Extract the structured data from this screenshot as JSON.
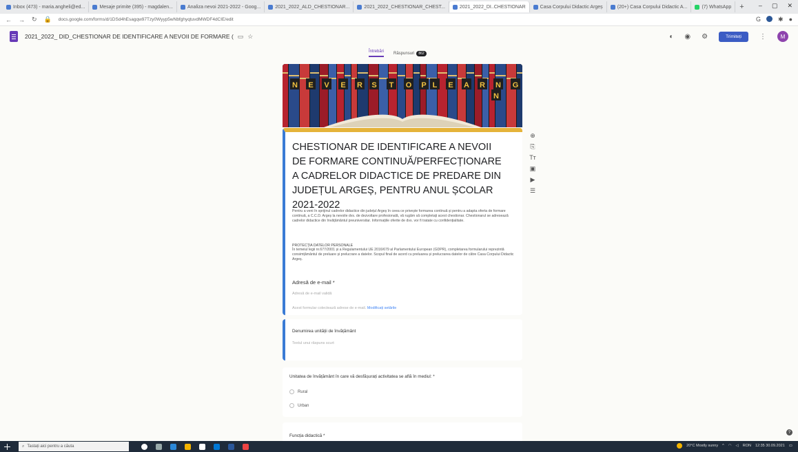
{
  "browser": {
    "tabs": [
      {
        "label": "Inbox (473) - maria.angheli@ed..."
      },
      {
        "label": "Mesaje primite (395) - magdalen..."
      },
      {
        "label": "Analiza nevoi 2021-2022 - Goog..."
      },
      {
        "label": "2021_2022_ALD_CHESTIONAR..."
      },
      {
        "label": "2021_2022_CHESTIONAR_CHEST..."
      },
      {
        "label": "2021_2022_DI..CHESTIONAR"
      },
      {
        "label": "Casa Corpului Didactic Argeș"
      },
      {
        "label": "(20+) Casa Corpului Didactic A..."
      },
      {
        "label": "(7) WhatsApp"
      }
    ],
    "new_tab": "+",
    "url": "docs.google.com/forms/d/1DSd4hEsagqw97Tzy0Wyyp5wNbfghyqtuvdMWDF4dCIE/edit"
  },
  "forms_header": {
    "doc_title": "2021_2022_ DID_CHESTIONAR DE IDENTIFICARE A NEVOII DE FORMARE (",
    "send_label": "Trimiteți",
    "avatar_letter": "M"
  },
  "form_tabs": {
    "questions": "Întrebări",
    "responses": "Răspunsuri",
    "responses_count": "862"
  },
  "banner": {
    "row1": [
      "N",
      "E",
      "V",
      "E",
      "R",
      "S",
      "T",
      "O",
      "P",
      "L",
      "E",
      "A",
      "R",
      "N",
      "I",
      "G"
    ],
    "row2": [
      "N"
    ]
  },
  "form": {
    "title": "CHESTIONAR DE IDENTIFICARE A NEVOII DE FORMARE  CONTINUĂ/PERFECȚIONARE A CADRELOR DIDACTICE DE PREDARE DIN JUDEȚUL ARGEȘ, PENTRU ANUL ȘCOLAR  2021-2022",
    "description": "Pentru a veni în sprijinul cadrelor didactice din județul Argeș în ceea ce privește formarea continuă și pentru a adapta oferta de formare continuă, a C.C.D. Argeș la nevoile dvs. de dezvoltare profesională, vă rugăm să completați acest chestionar. Chestionarul se adresează cadrelor didactice din învățământul preuniversitar. Informațiile oferite de dvs. vor fi tratate cu confidențialitate.",
    "protection_heading": "PROTECȚIA DATELOR PERSONALE",
    "protection_text": "În temeiul legii nr.677/2001 și a Regulamentului UE 2016/679 al Parlamentului European (GDPR), completarea formularului reprezintă consimțământul de preluare și prelucrare a datelor. Scopul final de acord cu preluarea și prelucrarea datelor de către Casa Corpului Didactic Argeș.",
    "email_label": "Adresă de e-mail *",
    "email_placeholder": "Adresă de e-mail validă",
    "email_note": "Acest formular colectează adrese de e-mail.",
    "email_link": "Modificați setările"
  },
  "questions": [
    {
      "label": "Denumirea unității de învățământ",
      "placeholder": "Textul unui răspuns scurt"
    },
    {
      "label": "Unitatea de învățământ în care vă desfășurați activitatea se află în mediul: *",
      "options": [
        "Rural",
        "Urban"
      ]
    },
    {
      "label": "Funcția didactică *"
    }
  ],
  "taskbar": {
    "search_placeholder": "Tastați aici pentru a căuta",
    "weather": "20°C  Mostly sunny",
    "lang": "RON",
    "time": "12:35",
    "date": "30.09.2021"
  },
  "colors": {
    "accent": "#673ab7",
    "send": "#3b5cc4",
    "header_band": "#e5b33a",
    "left_bar": "#3a7bd5"
  }
}
